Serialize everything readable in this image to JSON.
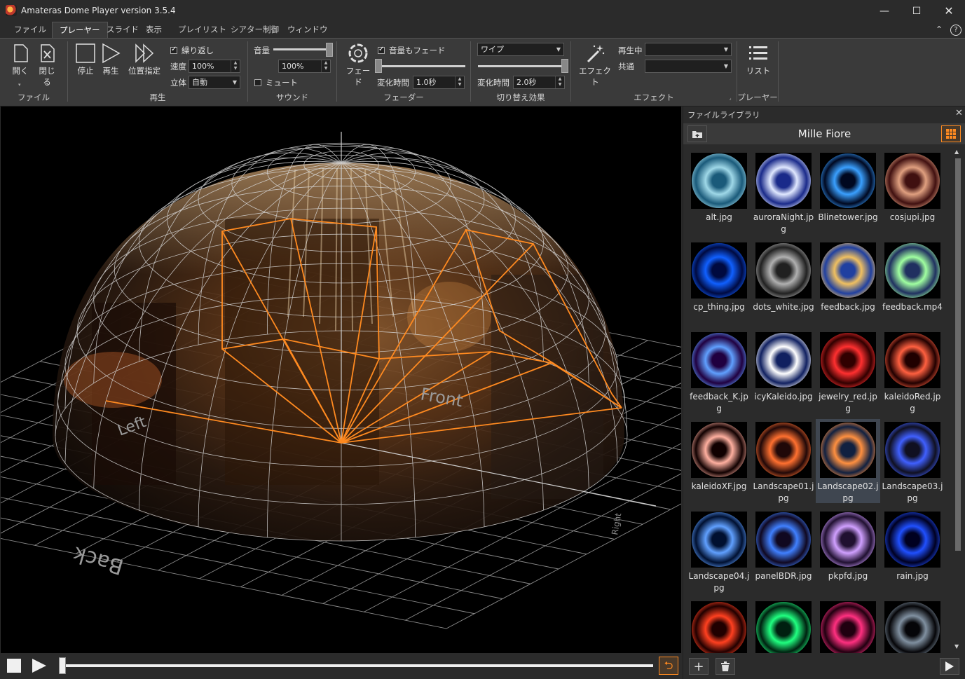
{
  "window": {
    "title": "Amateras Dome Player version 3.5.4"
  },
  "menu": {
    "tabs": [
      "ファイル",
      "プレーヤー",
      "スライド",
      "表示",
      "プレイリスト",
      "シアター制御",
      "ウィンドウ"
    ],
    "active": 1
  },
  "ribbon": {
    "file": {
      "open": "開く",
      "close": "閉じる",
      "label": "ファイル"
    },
    "play": {
      "stop": "停止",
      "play": "再生",
      "seek": "位置指定",
      "repeat": "繰り返し",
      "speed_label": "速度",
      "speed_value": "100%",
      "stereo_label": "立体",
      "stereo_value": "自動",
      "label": "再生"
    },
    "sound": {
      "volume_label": "音量",
      "volume_value": "100%",
      "volume_level": 1.0,
      "mute": "ミュート",
      "label": "サウンド"
    },
    "fader": {
      "fade": "フェード",
      "fade_sound": "音量もフェード",
      "time_label": "変化時間",
      "time_value": "1.0秒",
      "level": 0.0,
      "label": "フェーダー"
    },
    "transition": {
      "type_value": "ワイプ",
      "time_label": "変化時間",
      "time_value": "2.0秒",
      "level": 1.0,
      "label": "切り替え効果"
    },
    "effect": {
      "button": "エフェクト",
      "playing_label": "再生中",
      "common_label": "共通",
      "label": "エフェクト"
    },
    "player": {
      "list": "リスト",
      "label": "プレーヤー"
    }
  },
  "viewport": {
    "labels": {
      "front": "Front",
      "left": "Left",
      "back": "Back",
      "right": "Right"
    }
  },
  "transport": {
    "progress": 0.0
  },
  "library": {
    "panel_title": "ファイルライブラリ",
    "folder_name": "Mille Fiore",
    "items": [
      {
        "name": "alt.jpg",
        "c1": "#9fd8e8",
        "c2": "#1a5a7a"
      },
      {
        "name": "auroraNight.jpg",
        "c1": "#e0e8ff",
        "c2": "#1a2a8a"
      },
      {
        "name": "Blinetower.jpg",
        "c1": "#3aa0ff",
        "c2": "#000820"
      },
      {
        "name": "cosjupi.jpg",
        "c1": "#e0a080",
        "c2": "#401010"
      },
      {
        "name": "cp_thing.jpg",
        "c1": "#1060ff",
        "c2": "#000a40"
      },
      {
        "name": "dots_white.jpg",
        "c1": "#b0b0b0",
        "c2": "#202020"
      },
      {
        "name": "feedback.jpg",
        "c1": "#f0c060",
        "c2": "#2040a0"
      },
      {
        "name": "feedback.mp4",
        "c1": "#a0ffa0",
        "c2": "#203060"
      },
      {
        "name": "feedback_K.jpg",
        "c1": "#60a0ff",
        "c2": "#200040"
      },
      {
        "name": "icyKaleido.jpg",
        "c1": "#ffffff",
        "c2": "#102060"
      },
      {
        "name": "jewelry_red.jpg",
        "c1": "#ff3030",
        "c2": "#300000"
      },
      {
        "name": "kaleidoRed.jpg",
        "c1": "#ff6040",
        "c2": "#200000"
      },
      {
        "name": "kaleidoXF.jpg",
        "c1": "#ffb0a0",
        "c2": "#100000"
      },
      {
        "name": "Landscape01.jpg",
        "c1": "#ff7030",
        "c2": "#200808"
      },
      {
        "name": "Landscape02.jpg",
        "c1": "#ff9040",
        "c2": "#102040"
      },
      {
        "name": "Landscape03.jpg",
        "c1": "#4060ff",
        "c2": "#101020"
      },
      {
        "name": "Landscape04.jpg",
        "c1": "#60a0ff",
        "c2": "#001030"
      },
      {
        "name": "panelBDR.jpg",
        "c1": "#4080ff",
        "c2": "#100820"
      },
      {
        "name": "pkpfd.jpg",
        "c1": "#d0a0ff",
        "c2": "#201030"
      },
      {
        "name": "rain.jpg",
        "c1": "#2050ff",
        "c2": "#000020"
      },
      {
        "name": "",
        "c1": "#ff4020",
        "c2": "#200000"
      },
      {
        "name": "",
        "c1": "#20ff80",
        "c2": "#002010"
      },
      {
        "name": "",
        "c1": "#ff3080",
        "c2": "#200010"
      },
      {
        "name": "",
        "c1": "#8090a0",
        "c2": "#050508"
      }
    ],
    "selected_index": 14
  }
}
